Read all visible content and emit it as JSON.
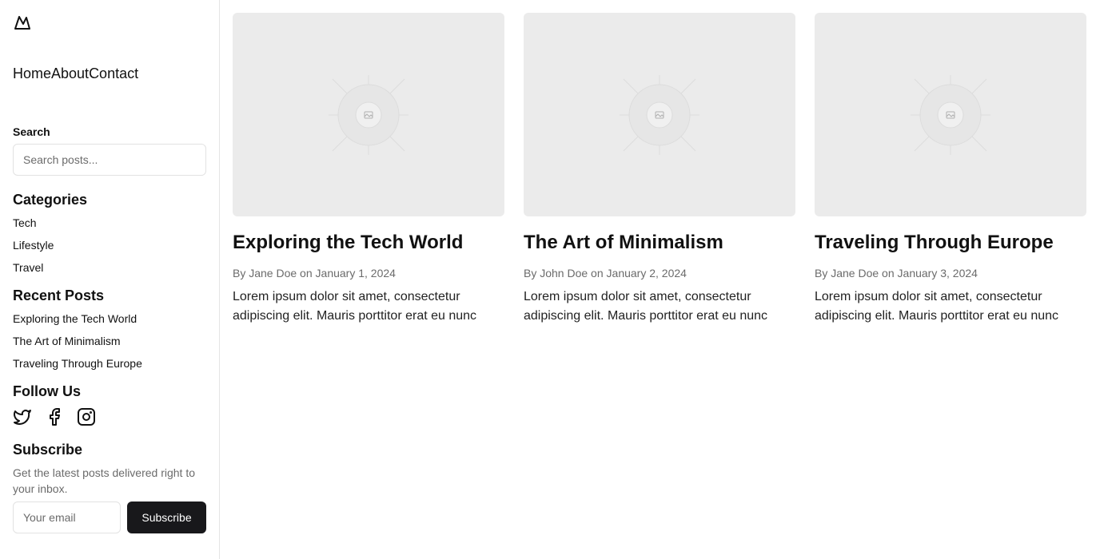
{
  "nav": {
    "links": [
      "Home",
      "About",
      "Contact"
    ]
  },
  "search": {
    "label": "Search",
    "placeholder": "Search posts..."
  },
  "categories": {
    "title": "Categories",
    "items": [
      "Tech",
      "Lifestyle",
      "Travel"
    ]
  },
  "recent": {
    "title": "Recent Posts",
    "items": [
      "Exploring the Tech World",
      "The Art of Minimalism",
      "Traveling Through Europe"
    ]
  },
  "follow": {
    "title": "Follow Us",
    "icons": [
      "twitter-icon",
      "facebook-icon",
      "instagram-icon"
    ]
  },
  "subscribe": {
    "title": "Subscribe",
    "text": "Get the latest posts delivered right to your inbox.",
    "placeholder": "Your email",
    "button": "Subscribe"
  },
  "posts": [
    {
      "title": "Exploring the Tech World",
      "by": "By ",
      "author": "Jane Doe",
      "on": " on ",
      "date": "January 1, 2024",
      "excerpt": "Lorem ipsum dolor sit amet, consectetur adipiscing elit. Mauris porttitor erat eu nunc"
    },
    {
      "title": "The Art of Minimalism",
      "by": "By ",
      "author": "John Doe",
      "on": " on ",
      "date": "January 2, 2024",
      "excerpt": "Lorem ipsum dolor sit amet, consectetur adipiscing elit. Mauris porttitor erat eu nunc"
    },
    {
      "title": "Traveling Through Europe",
      "by": "By ",
      "author": "Jane Doe",
      "on": " on ",
      "date": "January 3, 2024",
      "excerpt": "Lorem ipsum dolor sit amet, consectetur adipiscing elit. Mauris porttitor erat eu nunc"
    }
  ],
  "colors": {
    "accent": "#18181b",
    "muted": "#6b6b6b",
    "placeholder_bg": "#ebebeb"
  }
}
